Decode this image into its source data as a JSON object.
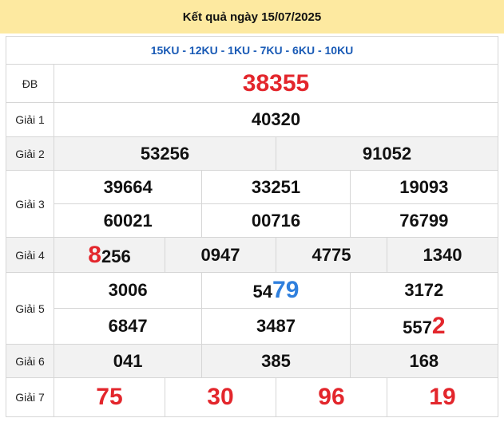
{
  "header": {
    "title": "Kết quả ngày 15/07/2025"
  },
  "codes": "15KU - 12KU - 1KU - 7KU - 6KU - 10KU",
  "labels": {
    "db": "ĐB",
    "g1": "Giải 1",
    "g2": "Giải 2",
    "g3": "Giải 3",
    "g4": "Giải 4",
    "g5": "Giải 5",
    "g6": "Giải 6",
    "g7": "Giải 7"
  },
  "prizes": {
    "db": "38355",
    "g1": "40320",
    "g2": [
      "53256",
      "91052"
    ],
    "g3": [
      "39664",
      "33251",
      "19093",
      "60021",
      "00716",
      "76799"
    ],
    "g4": [
      {
        "pre": "",
        "hl": "8",
        "post": "256"
      },
      {
        "pre": "0947",
        "hl": "",
        "post": ""
      },
      {
        "pre": "4775",
        "hl": "",
        "post": ""
      },
      {
        "pre": "1340",
        "hl": "",
        "post": ""
      }
    ],
    "g5": [
      {
        "pre": "3006",
        "hl": ""
      },
      {
        "pre": "54",
        "hl": "79"
      },
      {
        "pre": "3172",
        "hl": ""
      },
      {
        "pre": "6847",
        "hl": ""
      },
      {
        "pre": "3487",
        "hl": ""
      },
      {
        "pre": "557",
        "hl": "2"
      }
    ],
    "g6": [
      "041",
      "385",
      "168"
    ],
    "g7": [
      "75",
      "30",
      "96",
      "19"
    ]
  },
  "colors": {
    "header_bg": "#fde9a0",
    "red": "#e3262c",
    "blue": "#2f7fdd",
    "code_blue": "#1a5bb6"
  }
}
